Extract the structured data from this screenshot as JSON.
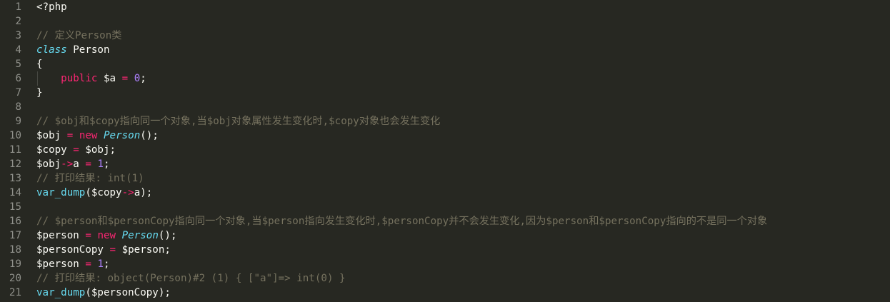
{
  "editor": {
    "theme_colors": {
      "background": "#272822",
      "foreground": "#f8f8f2",
      "comment": "#75715e",
      "keyword": "#66d9ef",
      "operator": "#f92672",
      "number": "#ae81ff",
      "line_number": "#8f908a"
    },
    "lines": [
      {
        "num": "1",
        "tokens": [
          {
            "t": "plain",
            "v": "<?php"
          }
        ]
      },
      {
        "num": "2",
        "tokens": []
      },
      {
        "num": "3",
        "tokens": [
          {
            "t": "cm",
            "v": "// 定义Person类"
          }
        ]
      },
      {
        "num": "4",
        "tokens": [
          {
            "t": "kw",
            "v": "class"
          },
          {
            "t": "plain",
            "v": " Person"
          }
        ]
      },
      {
        "num": "5",
        "tokens": [
          {
            "t": "plain",
            "v": "{"
          }
        ]
      },
      {
        "num": "6",
        "tokens": [
          {
            "t": "plain",
            "v": "    "
          },
          {
            "t": "mod",
            "v": "public"
          },
          {
            "t": "plain",
            "v": " $a "
          },
          {
            "t": "op",
            "v": "="
          },
          {
            "t": "plain",
            "v": " "
          },
          {
            "t": "num",
            "v": "0"
          },
          {
            "t": "plain",
            "v": ";"
          }
        ]
      },
      {
        "num": "7",
        "tokens": [
          {
            "t": "plain",
            "v": "}"
          }
        ]
      },
      {
        "num": "8",
        "tokens": []
      },
      {
        "num": "9",
        "tokens": [
          {
            "t": "cm",
            "v": "// $obj和$copy指向同一个对象,当$obj对象属性发生变化时,$copy对象也会发生变化"
          }
        ]
      },
      {
        "num": "10",
        "tokens": [
          {
            "t": "plain",
            "v": "$obj "
          },
          {
            "t": "op",
            "v": "="
          },
          {
            "t": "plain",
            "v": " "
          },
          {
            "t": "mod",
            "v": "new"
          },
          {
            "t": "plain",
            "v": " "
          },
          {
            "t": "cls",
            "v": "Person"
          },
          {
            "t": "plain",
            "v": "();"
          }
        ]
      },
      {
        "num": "11",
        "tokens": [
          {
            "t": "plain",
            "v": "$copy "
          },
          {
            "t": "op",
            "v": "="
          },
          {
            "t": "plain",
            "v": " $obj;"
          }
        ]
      },
      {
        "num": "12",
        "tokens": [
          {
            "t": "plain",
            "v": "$obj"
          },
          {
            "t": "op",
            "v": "->"
          },
          {
            "t": "plain",
            "v": "a "
          },
          {
            "t": "op",
            "v": "="
          },
          {
            "t": "plain",
            "v": " "
          },
          {
            "t": "num",
            "v": "1"
          },
          {
            "t": "plain",
            "v": ";"
          }
        ]
      },
      {
        "num": "13",
        "tokens": [
          {
            "t": "cm",
            "v": "// 打印结果: int(1)"
          }
        ]
      },
      {
        "num": "14",
        "tokens": [
          {
            "t": "fn",
            "v": "var_dump"
          },
          {
            "t": "plain",
            "v": "($copy"
          },
          {
            "t": "op",
            "v": "->"
          },
          {
            "t": "plain",
            "v": "a);"
          }
        ]
      },
      {
        "num": "15",
        "tokens": []
      },
      {
        "num": "16",
        "tokens": [
          {
            "t": "cm",
            "v": "// $person和$personCopy指向同一个对象,当$person指向发生变化时,$personCopy并不会发生变化,因为$person和$personCopy指向的不是同一个对象"
          }
        ]
      },
      {
        "num": "17",
        "tokens": [
          {
            "t": "plain",
            "v": "$person "
          },
          {
            "t": "op",
            "v": "="
          },
          {
            "t": "plain",
            "v": " "
          },
          {
            "t": "mod",
            "v": "new"
          },
          {
            "t": "plain",
            "v": " "
          },
          {
            "t": "cls",
            "v": "Person"
          },
          {
            "t": "plain",
            "v": "();"
          }
        ]
      },
      {
        "num": "18",
        "tokens": [
          {
            "t": "plain",
            "v": "$personCopy "
          },
          {
            "t": "op",
            "v": "="
          },
          {
            "t": "plain",
            "v": " $person;"
          }
        ]
      },
      {
        "num": "19",
        "tokens": [
          {
            "t": "plain",
            "v": "$person "
          },
          {
            "t": "op",
            "v": "="
          },
          {
            "t": "plain",
            "v": " "
          },
          {
            "t": "num",
            "v": "1"
          },
          {
            "t": "plain",
            "v": ";"
          }
        ]
      },
      {
        "num": "20",
        "tokens": [
          {
            "t": "cm",
            "v": "// 打印结果: object(Person)#2 (1) { [\"a\"]=> int(0) }"
          }
        ]
      },
      {
        "num": "21",
        "tokens": [
          {
            "t": "fn",
            "v": "var_dump"
          },
          {
            "t": "plain",
            "v": "($personCopy);"
          }
        ]
      }
    ]
  }
}
